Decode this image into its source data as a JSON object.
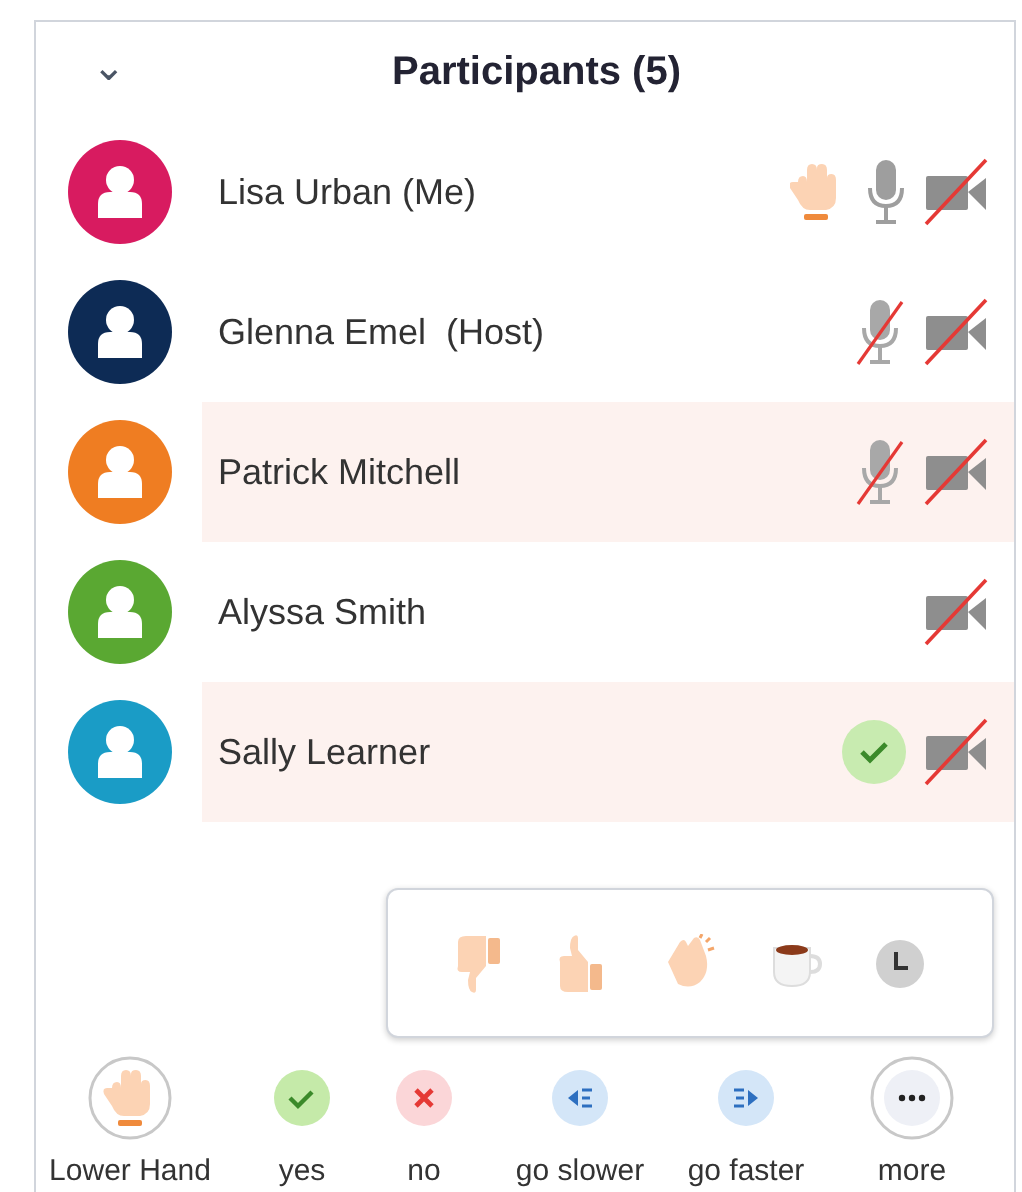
{
  "panel": {
    "title": "Participants (5)",
    "collapse_icon": "⌄"
  },
  "participants": [
    {
      "name": "Lisa Urban (Me)",
      "color": "#d81b60",
      "selected": false,
      "hand_raised": true,
      "audio_connected": true,
      "mic_muted": false,
      "video_off": true,
      "said_yes": false
    },
    {
      "name": "Glenna Emel  (Host)",
      "color": "#0d2b55",
      "selected": false,
      "hand_raised": false,
      "audio_connected": true,
      "mic_muted": true,
      "video_off": true,
      "said_yes": false
    },
    {
      "name": "Patrick Mitchell",
      "color": "#ef7d22",
      "selected": true,
      "hand_raised": false,
      "audio_connected": true,
      "mic_muted": true,
      "video_off": true,
      "said_yes": false
    },
    {
      "name": "Alyssa Smith",
      "color": "#5aa832",
      "selected": false,
      "hand_raised": false,
      "audio_connected": false,
      "video_off": true,
      "said_yes": false
    },
    {
      "name": "Sally Learner",
      "color": "#1a9cc6",
      "selected": true,
      "hand_raised": false,
      "audio_connected": false,
      "video_off": true,
      "said_yes": true
    }
  ],
  "reactions_popup": {
    "open": true,
    "items": [
      {
        "kind": "thumbs-down"
      },
      {
        "kind": "thumbs-up"
      },
      {
        "kind": "clap"
      },
      {
        "kind": "coffee"
      },
      {
        "kind": "clock"
      }
    ]
  },
  "actions": [
    {
      "kind": "hand",
      "label": "Lower Hand",
      "active": true
    },
    {
      "kind": "yes",
      "label": "yes",
      "active": false
    },
    {
      "kind": "no",
      "label": "no",
      "active": false
    },
    {
      "kind": "slower",
      "label": "go slower",
      "active": false
    },
    {
      "kind": "faster",
      "label": "go faster",
      "active": false
    },
    {
      "kind": "more",
      "label": "more",
      "active": true
    }
  ]
}
